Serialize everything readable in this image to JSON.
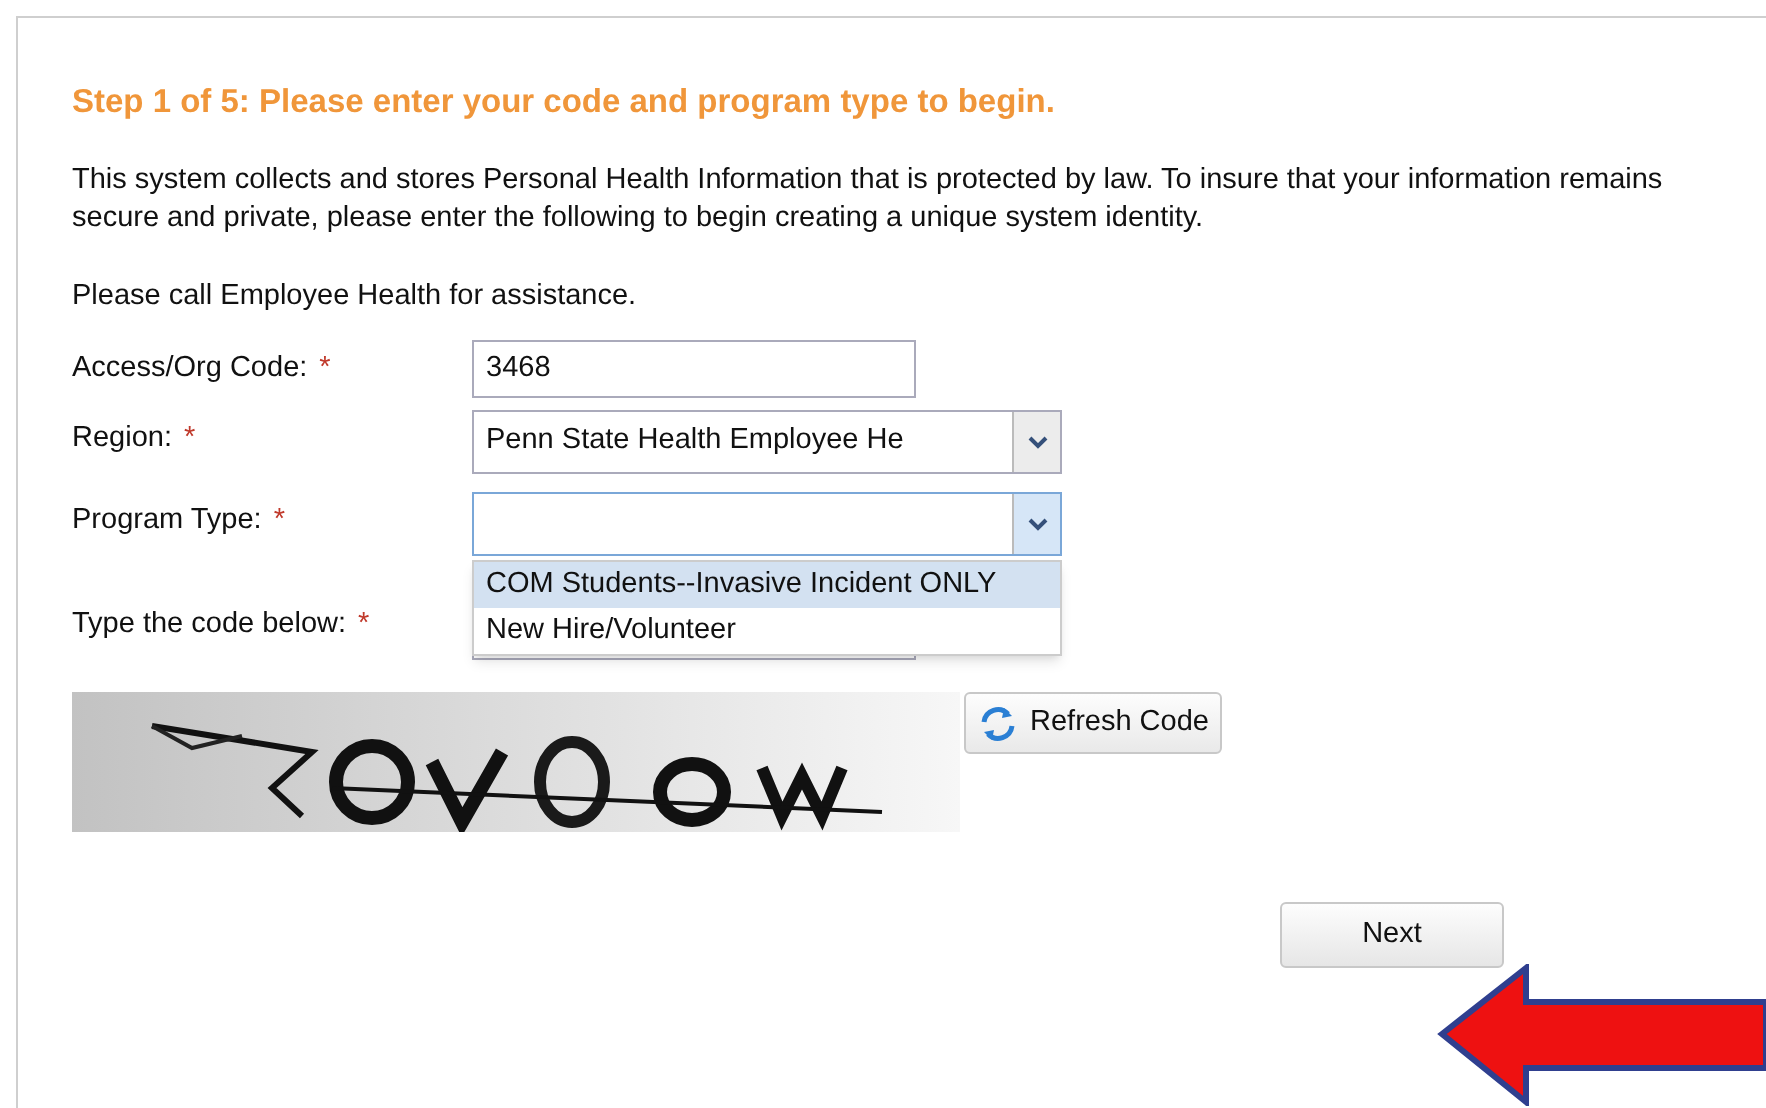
{
  "heading": "Step 1 of 5: Please enter your code and program type to begin.",
  "intro": "This system collects and stores Personal Health Information that is protected by law. To insure that your information remains secure and private, please enter the following to begin creating a unique system identity.",
  "help": "Please call Employee Health for assistance.",
  "fields": [
    {
      "kind": "text",
      "label": "Access/Org Code:",
      "mark": "*",
      "value": "3468"
    },
    {
      "kind": "select",
      "label": "Region:",
      "mark": "*",
      "value": "Penn State Health Employee He",
      "expanded": false
    },
    {
      "kind": "select",
      "label": "Program Type:",
      "mark": "*",
      "expanded": true,
      "options": [
        {
          "label": "COM Students--Invasive Incident ONLY",
          "selected": true
        },
        {
          "label": "New Hire/Volunteer",
          "selected": false
        }
      ]
    },
    {
      "kind": "captcha",
      "label": "Type the code below:",
      "mark": "*"
    }
  ],
  "refresh_button": "Refresh Code",
  "next_button": "Next"
}
